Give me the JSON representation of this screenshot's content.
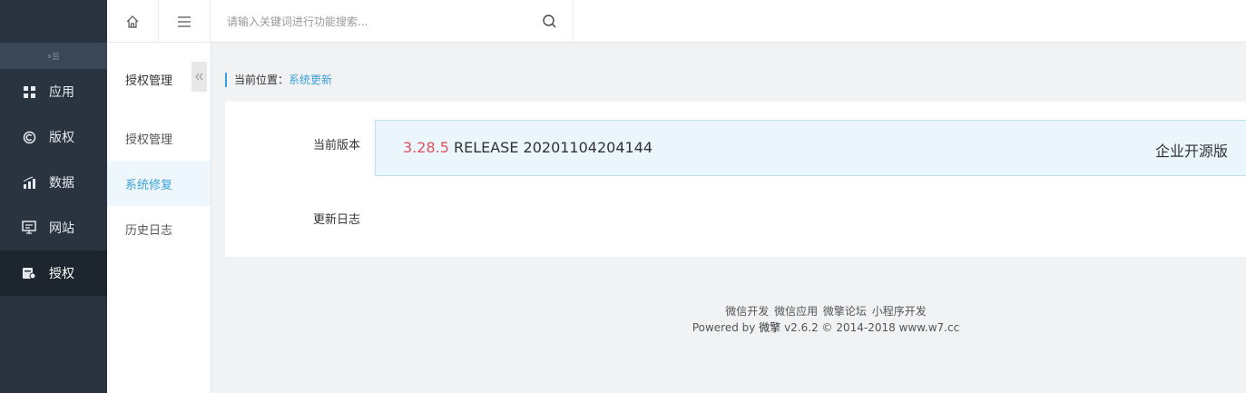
{
  "sidebar": {
    "collapse_icon": "collapse-left-icon",
    "items": [
      {
        "label": "应用",
        "icon": "grid-icon"
      },
      {
        "label": "版权",
        "icon": "copyright-icon"
      },
      {
        "label": "数据",
        "icon": "bar-chart-icon"
      },
      {
        "label": "网站",
        "icon": "monitor-icon"
      },
      {
        "label": "授权",
        "icon": "license-icon",
        "active": true
      }
    ]
  },
  "topbar": {
    "home_icon": "home-icon",
    "menu_icon": "menu-icon",
    "search_placeholder": "请输入关键词进行功能搜索...",
    "search_icon": "search-icon"
  },
  "submenu": {
    "title": "授权管理",
    "fold_icon": "double-chevron-left-icon",
    "items": [
      {
        "label": "授权管理"
      },
      {
        "label": "系统修复",
        "active": true
      },
      {
        "label": "历史日志"
      }
    ]
  },
  "breadcrumb": {
    "prefix": "当前位置：",
    "current": "系统更新"
  },
  "panel": {
    "current_version_label": "当前版本",
    "version_number": "3.28.5",
    "version_release": "RELEASE 20201104204144",
    "edition": "企业开源版",
    "changelog_label": "更新日志"
  },
  "footer": {
    "links": [
      "微信开发",
      "微信应用",
      "微擎论坛",
      "小程序开发"
    ],
    "powered_prefix": "Powered by",
    "brand": "微擎",
    "powered_suffix": "v2.6.2 © 2014-2018 www.w7.cc"
  },
  "colors": {
    "sidebar_bg": "#2a3441",
    "accent": "#3ba1d8",
    "version_red": "#e0515e"
  }
}
